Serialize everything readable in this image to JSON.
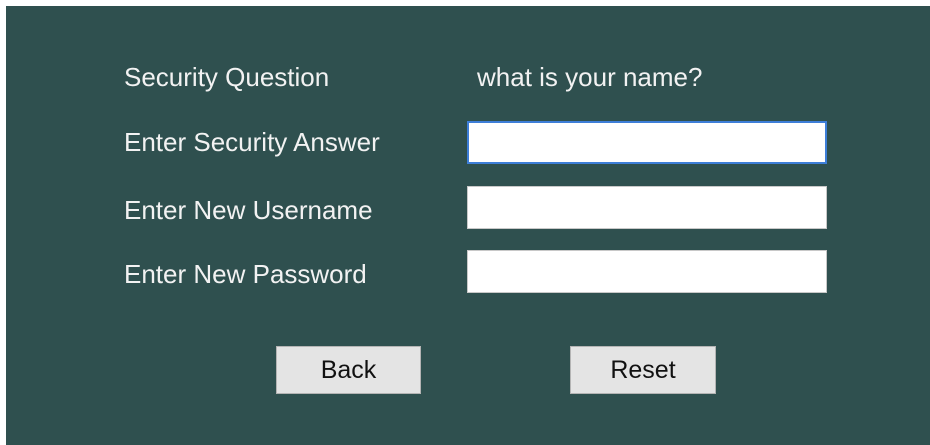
{
  "form": {
    "security_question_label": "Security Question",
    "security_question_value": "what is your name?",
    "answer_label": "Enter Security Answer",
    "answer_value": "",
    "username_label": "Enter New Username",
    "username_value": "",
    "password_label": "Enter New Password",
    "password_value": ""
  },
  "buttons": {
    "back_label": "Back",
    "reset_label": "Reset"
  },
  "colors": {
    "panel_background": "#2f504f",
    "label_text": "#f2f2f2",
    "button_background": "#e4e4e4",
    "focus_border": "#3d7ed8"
  }
}
